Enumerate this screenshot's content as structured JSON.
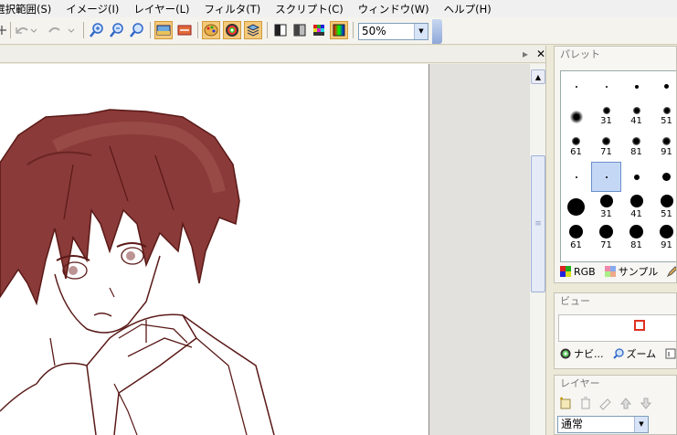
{
  "menu": {
    "items": [
      "選択範囲(S)",
      "イメージ(I)",
      "レイヤー(L)",
      "フィルタ(T)",
      "スクリプト(C)",
      "ウィンドウ(W)",
      "ヘルプ(H)"
    ]
  },
  "toolbar": {
    "zoom_value": "50%"
  },
  "document": {
    "pin_glyph": "▸",
    "close_glyph": "✕"
  },
  "palette": {
    "title": "パレット",
    "brushes": [
      {
        "size": 2,
        "label": ""
      },
      {
        "size": 2,
        "label": ""
      },
      {
        "size": 4,
        "label": ""
      },
      {
        "size": 5,
        "label": ""
      },
      {
        "size": 14,
        "label": ""
      },
      {
        "size": 8,
        "label": "31"
      },
      {
        "size": 8,
        "label": "41"
      },
      {
        "size": 8,
        "label": "51"
      },
      {
        "size": 9,
        "label": "61"
      },
      {
        "size": 9,
        "label": "71"
      },
      {
        "size": 9,
        "label": "81"
      },
      {
        "size": 9,
        "label": "91"
      },
      {
        "size": 2,
        "label": ""
      },
      {
        "size": 2,
        "label": ""
      },
      {
        "size": 6,
        "label": ""
      },
      {
        "size": 9,
        "label": ""
      },
      {
        "size": 19,
        "label": ""
      },
      {
        "size": 14,
        "label": "31"
      },
      {
        "size": 14,
        "label": "41"
      },
      {
        "size": 14,
        "label": "51"
      },
      {
        "size": 15,
        "label": "61"
      },
      {
        "size": 15,
        "label": "71"
      },
      {
        "size": 15,
        "label": "81"
      },
      {
        "size": 15,
        "label": "91"
      }
    ],
    "selected_index": 13,
    "tabs": [
      "RGB",
      "サンプル"
    ]
  },
  "view": {
    "title": "ビュー",
    "tabs": [
      "ナビ...",
      "ズーム"
    ]
  },
  "layers": {
    "title": "レイヤー",
    "blend_mode": "通常"
  }
}
